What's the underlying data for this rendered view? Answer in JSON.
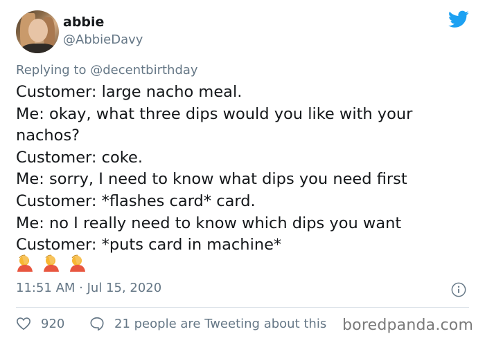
{
  "tweet": {
    "author": {
      "display_name": "abbie",
      "handle": "@AbbieDavy"
    },
    "replying_to": {
      "prefix": "Replying to",
      "mention": "@decentbirthday"
    },
    "lines": [
      "Customer: large nacho meal.",
      "Me: okay, what three dips would you like with your",
      "nachos?",
      "Customer: coke.",
      "Me: sorry, I need to know what dips you need first",
      "Customer: *flashes card* card.",
      "Me: no I really need to know which dips you want",
      "Customer: *puts card in machine*"
    ],
    "emoji_count": 3,
    "emoji_name": "person-facepalming-icon",
    "timestamp": "11:51 AM · Jul 15, 2020",
    "likes": "920",
    "conversation": "21 people are Tweeting about this"
  },
  "watermark": "boredpanda.com",
  "colors": {
    "twitter_blue": "#1da1f2",
    "muted": "#657786",
    "text": "#14171a"
  }
}
